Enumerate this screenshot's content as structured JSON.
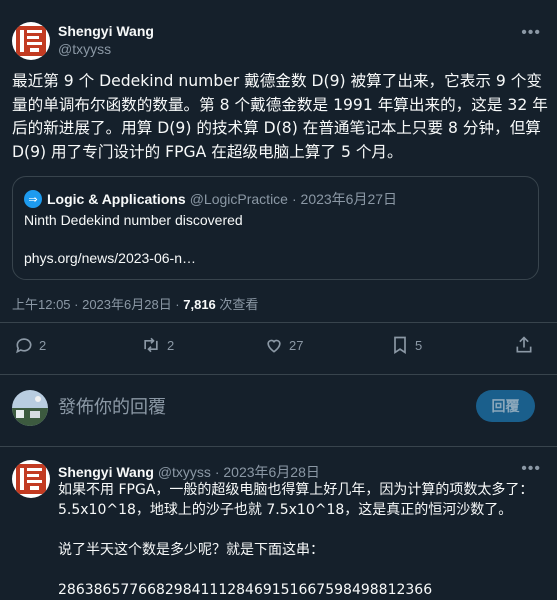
{
  "tweet": {
    "author_name": "Shengyi Wang",
    "author_handle": "@txyyss",
    "text": "最近第 9 个 Dedekind number 戴德金数 D(9) 被算了出来，它表示 9 个变量的单调布尔函数的数量。第 8 个戴德金数是 1991 年算出来的，这是 32 年后的新进展了。用算 D(9) 的技术算 D(8) 在普通笔记本上只要 8 分钟，但算 D(9) 用了专门设计的 FPGA 在超级电脑上算了 5 个月。",
    "quote": {
      "author_name": "Logic & Applications",
      "author_handle": "@LogicPractice",
      "date": "· 2023年6月27日",
      "title": "Ninth Dedekind number discovered",
      "link": "phys.org/news/2023-06-n…"
    },
    "time": "上午12:05 · 2023年6月28日 · ",
    "views_count": "7,816",
    "views_label": " 次查看",
    "counts": {
      "replies": "2",
      "retweets": "2",
      "likes": "27",
      "bookmarks": "5"
    }
  },
  "compose": {
    "placeholder": "發佈你的回覆",
    "button_label": "回覆"
  },
  "reply": {
    "author_name": "Shengyi Wang",
    "author_handle": "@txyyss",
    "date": "· 2023年6月28日",
    "lines": [
      "如果不用 FPGA，一般的超级电脑也得算上好几年，因为计算的项数太多了：5.5x10^18，地球上的沙子也就 7.5x10^18，这是真正的恒河沙数了。",
      "",
      "说了半天这个数是多少呢？就是下面这串：",
      "",
      "286386577668298411128469151667598498812366"
    ]
  },
  "colors": {
    "background": "#15202b",
    "text": "#f7f9f9",
    "muted": "#8b98a5",
    "border": "#38444d",
    "accent": "#1d9bf0",
    "seal": "#c23b22"
  },
  "icons": {
    "more": "more-icon",
    "reply": "reply-icon",
    "retweet": "retweet-icon",
    "like": "heart-icon",
    "bookmark": "bookmark-icon",
    "share": "share-icon"
  }
}
